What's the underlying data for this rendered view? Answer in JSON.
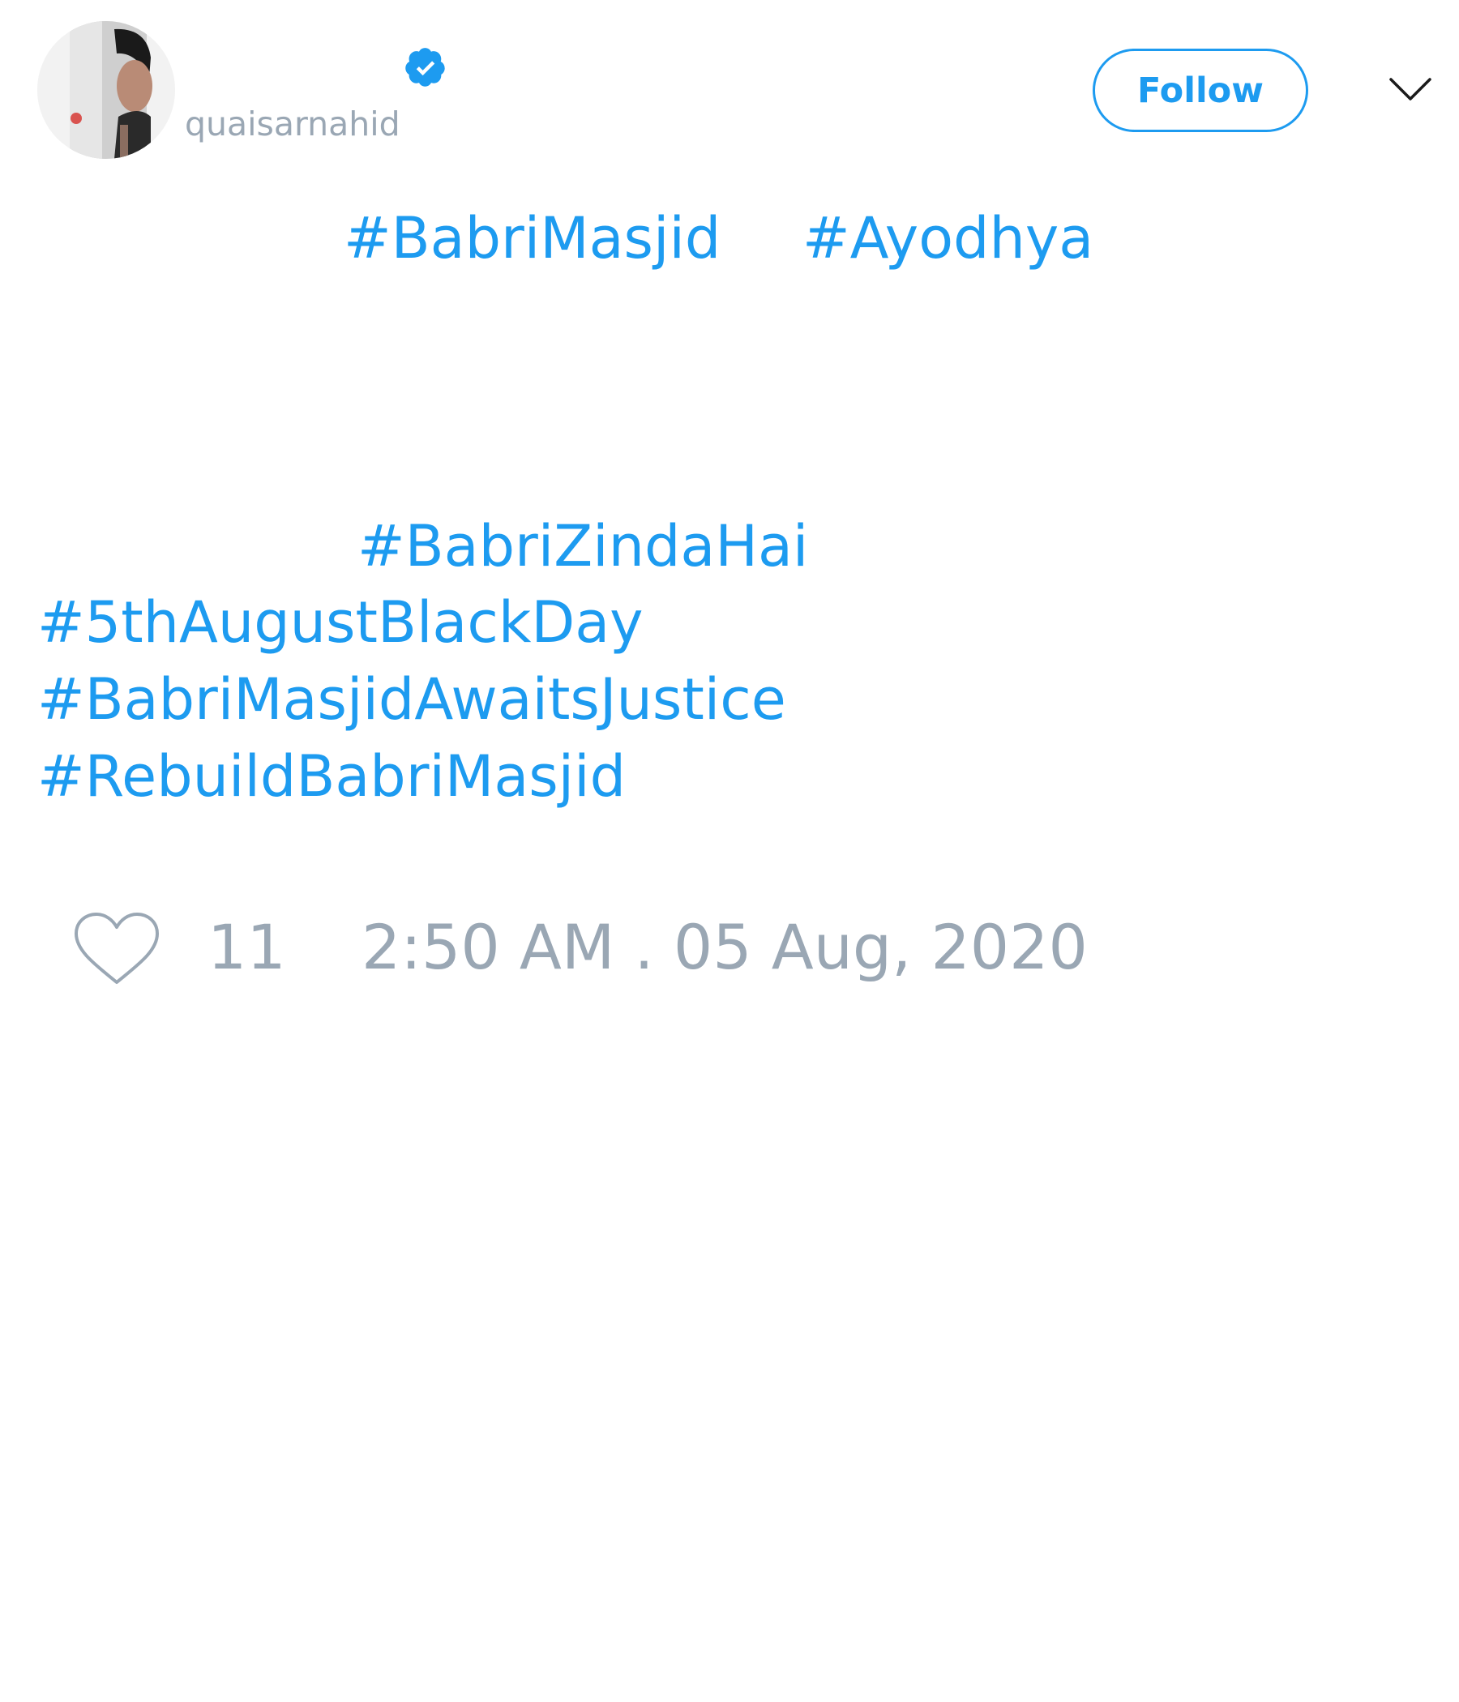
{
  "author": {
    "handle": "quaisarnahid",
    "avatar_icon": "profile-photo",
    "verified_icon": "verified-badge-icon"
  },
  "actions": {
    "follow_label": "Follow",
    "menu_icon": "chevron-down-icon"
  },
  "tweet": {
    "hashtags": [
      "#BabriMasjid",
      "#Ayodhya",
      "#BabriZindaHai",
      "#5thAugustBlackDay",
      "#BabriMasjidAwaitsJustice",
      "#RebuildBabriMasjid"
    ]
  },
  "footer": {
    "like_icon": "heart-icon",
    "like_count": "11",
    "timestamp": "2:50 AM . 05 Aug, 2020"
  },
  "colors": {
    "accent": "#1d9bf0",
    "muted_text": "#9aa7b4",
    "background": "#ffffff"
  }
}
